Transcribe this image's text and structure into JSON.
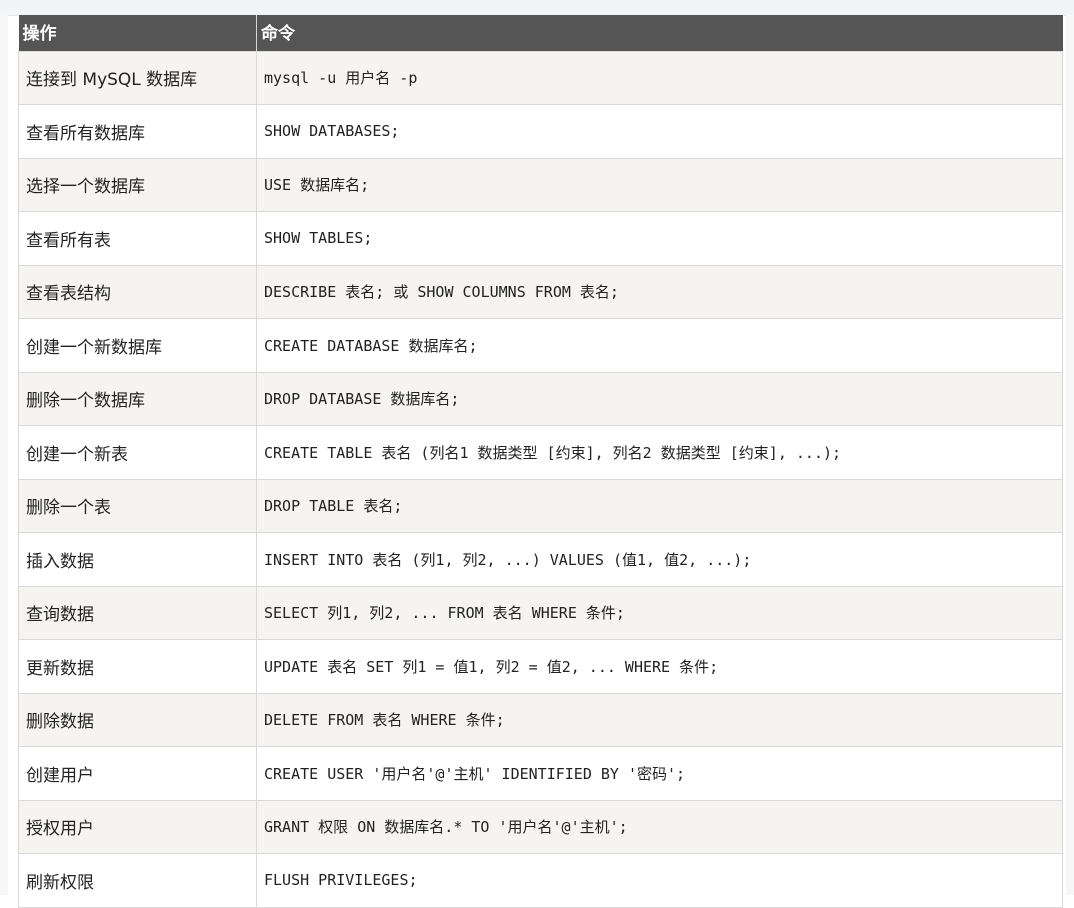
{
  "table": {
    "headers": [
      "操作",
      "命令"
    ],
    "rows": [
      {
        "op": "连接到 MySQL 数据库",
        "cmd": "mysql -u 用户名 -p"
      },
      {
        "op": "查看所有数据库",
        "cmd": "SHOW DATABASES;"
      },
      {
        "op": "选择一个数据库",
        "cmd": "USE 数据库名;"
      },
      {
        "op": "查看所有表",
        "cmd": "SHOW TABLES;"
      },
      {
        "op": "查看表结构",
        "cmd": "DESCRIBE 表名; 或 SHOW COLUMNS FROM 表名;"
      },
      {
        "op": "创建一个新数据库",
        "cmd": "CREATE DATABASE 数据库名;"
      },
      {
        "op": "删除一个数据库",
        "cmd": "DROP DATABASE 数据库名;"
      },
      {
        "op": "创建一个新表",
        "cmd": "CREATE TABLE 表名 (列名1 数据类型 [约束], 列名2 数据类型 [约束], ...);"
      },
      {
        "op": "删除一个表",
        "cmd": "DROP TABLE 表名;"
      },
      {
        "op": "插入数据",
        "cmd": "INSERT INTO 表名 (列1, 列2, ...) VALUES (值1, 值2, ...);"
      },
      {
        "op": "查询数据",
        "cmd": "SELECT 列1, 列2, ... FROM 表名 WHERE 条件;"
      },
      {
        "op": "更新数据",
        "cmd": "UPDATE 表名 SET 列1 = 值1, 列2 = 值2, ... WHERE 条件;"
      },
      {
        "op": "删除数据",
        "cmd": "DELETE FROM 表名 WHERE 条件;"
      },
      {
        "op": "创建用户",
        "cmd": "CREATE USER '用户名'@'主机' IDENTIFIED BY '密码';"
      },
      {
        "op": "授权用户",
        "cmd": "GRANT 权限 ON 数据库名.* TO '用户名'@'主机';"
      },
      {
        "op": "刷新权限",
        "cmd": "FLUSH PRIVILEGES;"
      }
    ]
  },
  "colors": {
    "header_bg": "#555555",
    "row_alt_bg": "#f5f4f1",
    "row_bg": "#ffffff"
  }
}
